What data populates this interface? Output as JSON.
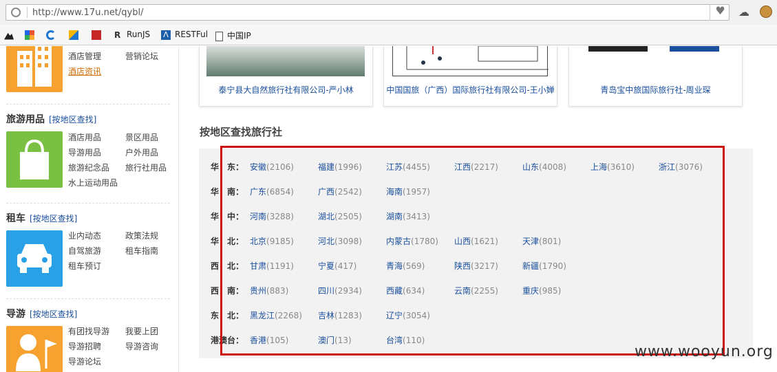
{
  "browser": {
    "url": "http://www.17u.net/qybl/",
    "bookmarks": [
      "RunJS",
      "RESTFul",
      "中国IP"
    ]
  },
  "sidebar": {
    "hotel": {
      "links": [
        "酒店管理",
        "营销论坛",
        "酒店资讯"
      ]
    },
    "supplies": {
      "title": "旅游用品",
      "area_link": "[按地区查找]",
      "links": [
        "酒店用品",
        "景区用品",
        "导游用品",
        "户外用品",
        "旅游纪念品",
        "旅行社用品",
        "水上运动用品"
      ]
    },
    "rental": {
      "title": "租车",
      "area_link": "[按地区查找]",
      "links": [
        "业内动态",
        "政策法规",
        "自驾旅游",
        "租车指南",
        "租车预订"
      ]
    },
    "guide": {
      "title": "导游",
      "area_link": "[按地区查找]",
      "links": [
        "有团找导游",
        "我要上团",
        "导游招聘",
        "导游咨询",
        "导游论坛"
      ]
    }
  },
  "cards": [
    {
      "caption": "泰宁县大自然旅行社有限公司-严小林"
    },
    {
      "caption": "中国国旅（广西）国际旅行社有限公司-王小婵"
    },
    {
      "caption": "青岛宝中旅国际旅行社-周业琛"
    }
  ],
  "area_title": "按地区查找旅行社",
  "regions": [
    {
      "label": "华　东：",
      "provinces": [
        {
          "name": "安徽",
          "count": "(2106)"
        },
        {
          "name": "福建",
          "count": "(1996)"
        },
        {
          "name": "江苏",
          "count": "(4455)"
        },
        {
          "name": "江西",
          "count": "(2217)"
        },
        {
          "name": "山东",
          "count": "(4008)"
        },
        {
          "name": "上海",
          "count": "(3610)"
        },
        {
          "name": "浙江",
          "count": "(3076)"
        }
      ]
    },
    {
      "label": "华　南：",
      "provinces": [
        {
          "name": "广东",
          "count": "(6854)"
        },
        {
          "name": "广西",
          "count": "(2542)"
        },
        {
          "name": "海南",
          "count": "(1957)"
        }
      ]
    },
    {
      "label": "华　中：",
      "provinces": [
        {
          "name": "河南",
          "count": "(3288)"
        },
        {
          "name": "湖北",
          "count": "(2505)"
        },
        {
          "name": "湖南",
          "count": "(3413)"
        }
      ]
    },
    {
      "label": "华　北：",
      "provinces": [
        {
          "name": "北京",
          "count": "(9185)"
        },
        {
          "name": "河北",
          "count": "(3098)"
        },
        {
          "name": "内蒙古",
          "count": "(1780)"
        },
        {
          "name": "山西",
          "count": "(1621)"
        },
        {
          "name": "天津",
          "count": "(801)"
        }
      ]
    },
    {
      "label": "西　北：",
      "provinces": [
        {
          "name": "甘肃",
          "count": "(1191)"
        },
        {
          "name": "宁夏",
          "count": "(417)"
        },
        {
          "name": "青海",
          "count": "(569)"
        },
        {
          "name": "陕西",
          "count": "(3217)"
        },
        {
          "name": "新疆",
          "count": "(1790)"
        }
      ]
    },
    {
      "label": "西　南：",
      "provinces": [
        {
          "name": "贵州",
          "count": "(883)"
        },
        {
          "name": "四川",
          "count": "(2934)"
        },
        {
          "name": "西藏",
          "count": "(634)"
        },
        {
          "name": "云南",
          "count": "(2255)"
        },
        {
          "name": "重庆",
          "count": "(985)"
        }
      ]
    },
    {
      "label": "东　北：",
      "provinces": [
        {
          "name": "黑龙江",
          "count": "(2268)"
        },
        {
          "name": "吉林",
          "count": "(1283)"
        },
        {
          "name": "辽宁",
          "count": "(3054)"
        }
      ]
    },
    {
      "label": "港澳台：",
      "provinces": [
        {
          "name": "香港",
          "count": "(105)"
        },
        {
          "name": "澳门",
          "count": "(13)"
        },
        {
          "name": "台湾",
          "count": "(110)"
        }
      ]
    }
  ],
  "watermark": "www.wooyun.org",
  "colors": {
    "link": "#1a4f9e",
    "highlight_box": "#cc1010",
    "hotel_tile": "#f7a230",
    "supplies_tile": "#7ac143",
    "rental_tile": "#2aa0e6"
  }
}
